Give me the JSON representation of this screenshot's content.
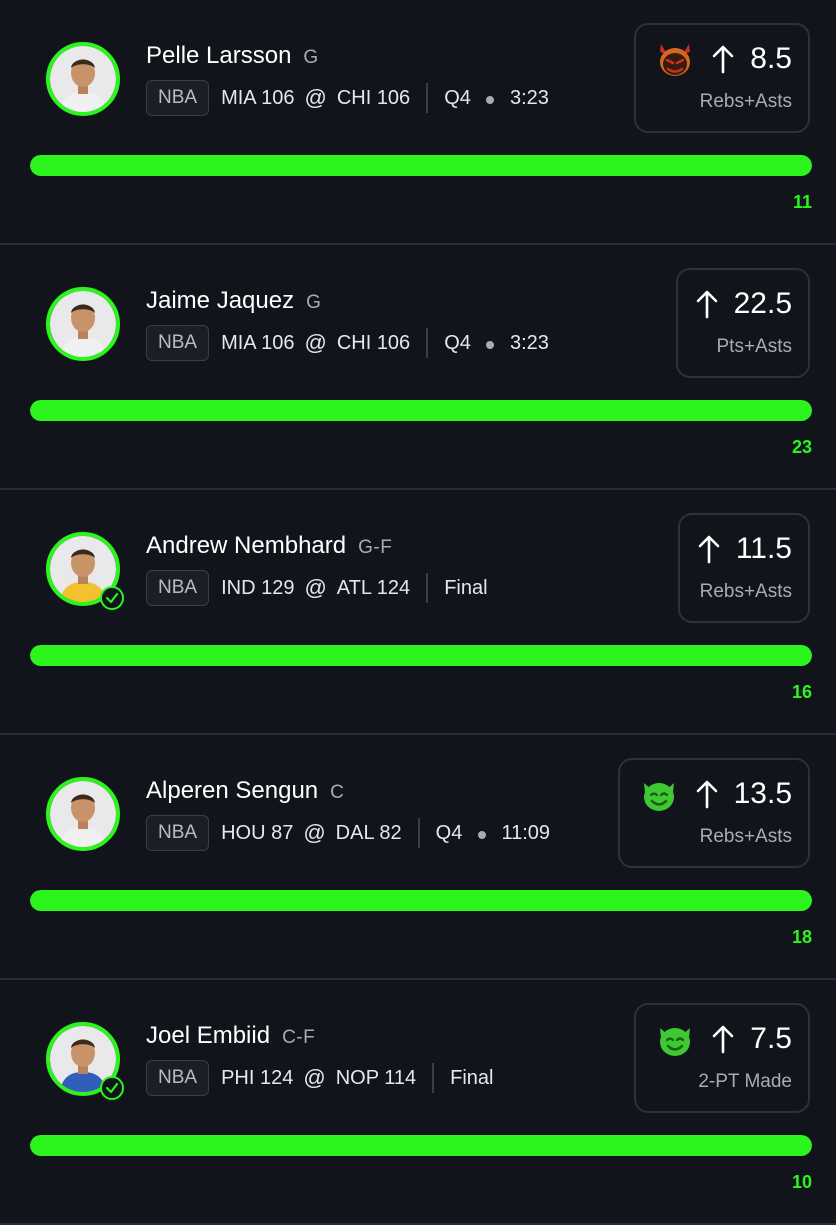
{
  "colors": {
    "background": "#12141c",
    "accent_green": "#2bf51d",
    "card_border": "#2e313c",
    "muted_text": "#a8abb6",
    "demon_red": "#c8321e",
    "goblin_green": "#3ec832"
  },
  "picks": [
    {
      "player": "Pelle Larsson",
      "position": "G",
      "league": "NBA",
      "away": "MIA 106",
      "at": "@",
      "home": "CHI 106",
      "status_period": "Q4",
      "status_clock": "3:23",
      "status_final": "",
      "emoji": "demon-icon",
      "line": "8.5",
      "stat": "Rebs+Asts",
      "actual": "11",
      "progress": 1.0,
      "finished": false,
      "jersey_color": "#f0f0f0"
    },
    {
      "player": "Jaime Jaquez",
      "position": "G",
      "league": "NBA",
      "away": "MIA 106",
      "at": "@",
      "home": "CHI 106",
      "status_period": "Q4",
      "status_clock": "3:23",
      "status_final": "",
      "emoji": "",
      "line": "22.5",
      "stat": "Pts+Asts",
      "actual": "23",
      "progress": 1.0,
      "finished": false,
      "jersey_color": "#f0f0f0"
    },
    {
      "player": "Andrew Nembhard",
      "position": "G-F",
      "league": "NBA",
      "away": "IND 129",
      "at": "@",
      "home": "ATL 124",
      "status_period": "",
      "status_clock": "",
      "status_final": "Final",
      "emoji": "",
      "line": "11.5",
      "stat": "Rebs+Asts",
      "actual": "16",
      "progress": 1.0,
      "finished": true,
      "jersey_color": "#f2c12e"
    },
    {
      "player": "Alperen Sengun",
      "position": "C",
      "league": "NBA",
      "away": "HOU 87",
      "at": "@",
      "home": "DAL 82",
      "status_period": "Q4",
      "status_clock": "11:09",
      "status_final": "",
      "emoji": "goblin-icon",
      "line": "13.5",
      "stat": "Rebs+Asts",
      "actual": "18",
      "progress": 1.0,
      "finished": false,
      "jersey_color": "#f0f0f0"
    },
    {
      "player": "Joel Embiid",
      "position": "C-F",
      "league": "NBA",
      "away": "PHI 124",
      "at": "@",
      "home": "NOP 114",
      "status_period": "",
      "status_clock": "",
      "status_final": "Final",
      "emoji": "goblin-icon",
      "line": "7.5",
      "stat": "2-PT Made",
      "actual": "10",
      "progress": 1.0,
      "finished": true,
      "jersey_color": "#2f5fb8"
    }
  ]
}
